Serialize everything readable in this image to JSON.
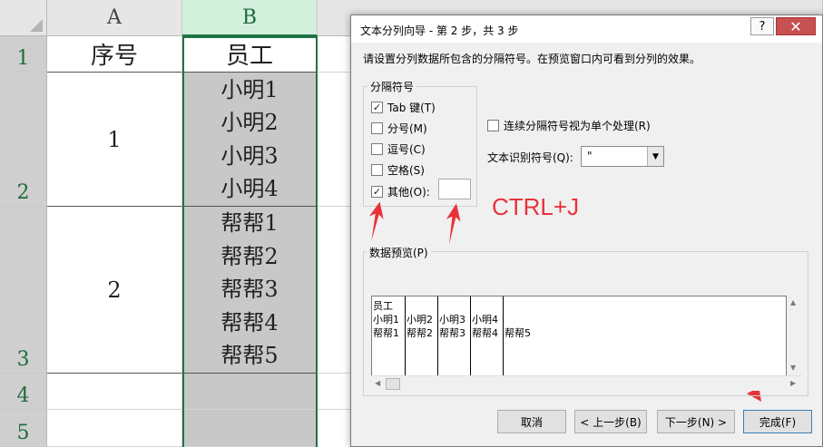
{
  "sheet": {
    "columns": [
      "A",
      "B"
    ],
    "rows": [
      "1",
      "2",
      "3",
      "4",
      "5"
    ],
    "header": {
      "a": "序号",
      "b": "员工"
    },
    "group1": {
      "num": "1",
      "names": [
        "小明1",
        "小明2",
        "小明3",
        "小明4"
      ]
    },
    "group2": {
      "num": "2",
      "names": [
        "帮帮1",
        "帮帮2",
        "帮帮3",
        "帮帮4",
        "帮帮5"
      ]
    }
  },
  "dialog": {
    "title": "文本分列向导 - 第 2 步，共 3 步",
    "help": "?",
    "close": "✕",
    "description": "请设置分列数据所包含的分隔符号。在预览窗口内可看到分列的效果。",
    "delimiter_group": "分隔符号",
    "checkboxes": [
      {
        "label": "Tab 键(T)",
        "checked": "✓"
      },
      {
        "label": "分号(M)",
        "checked": ""
      },
      {
        "label": "逗号(C)",
        "checked": ""
      },
      {
        "label": "空格(S)",
        "checked": ""
      },
      {
        "label": "其他(O):",
        "checked": "✓"
      }
    ],
    "consecutive": {
      "label": "连续分隔符号视为单个处理(R)",
      "checked": ""
    },
    "qualifier": {
      "label": "文本识别符号(Q):",
      "value": "\""
    },
    "annotation": "CTRL+J",
    "preview": {
      "label": "数据预览(P)",
      "columns": [
        [
          "员工",
          "小明1",
          "帮帮1"
        ],
        [
          "",
          "小明2",
          "帮帮2"
        ],
        [
          "",
          "小明3",
          "帮帮3"
        ],
        [
          "",
          "小明4",
          "帮帮4"
        ],
        [
          "",
          "",
          "帮帮5"
        ]
      ]
    },
    "buttons": {
      "cancel": "取消",
      "back": "< 上一步(B)",
      "next": "下一步(N) >",
      "finish": "完成(F)"
    }
  },
  "colors": {
    "excel_green": "#217346",
    "annotation_red": "#e8323a"
  }
}
